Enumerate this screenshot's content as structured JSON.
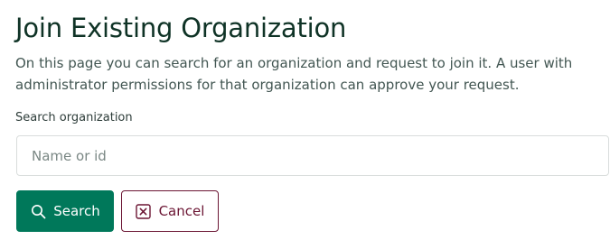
{
  "page": {
    "title": "Join Existing Organization",
    "description": "On this page you can search for an organization and request to join it. A user with administrator permissions for that organization can approve your request."
  },
  "search": {
    "label": "Search organization",
    "placeholder": "Name or id",
    "value": ""
  },
  "actions": {
    "search_label": "Search",
    "cancel_label": "Cancel"
  },
  "icons": {
    "search": "search-icon",
    "cancel": "close-square-icon"
  },
  "colors": {
    "primary": "#00785a",
    "cancel": "#6b1533",
    "title": "#0f3326"
  }
}
